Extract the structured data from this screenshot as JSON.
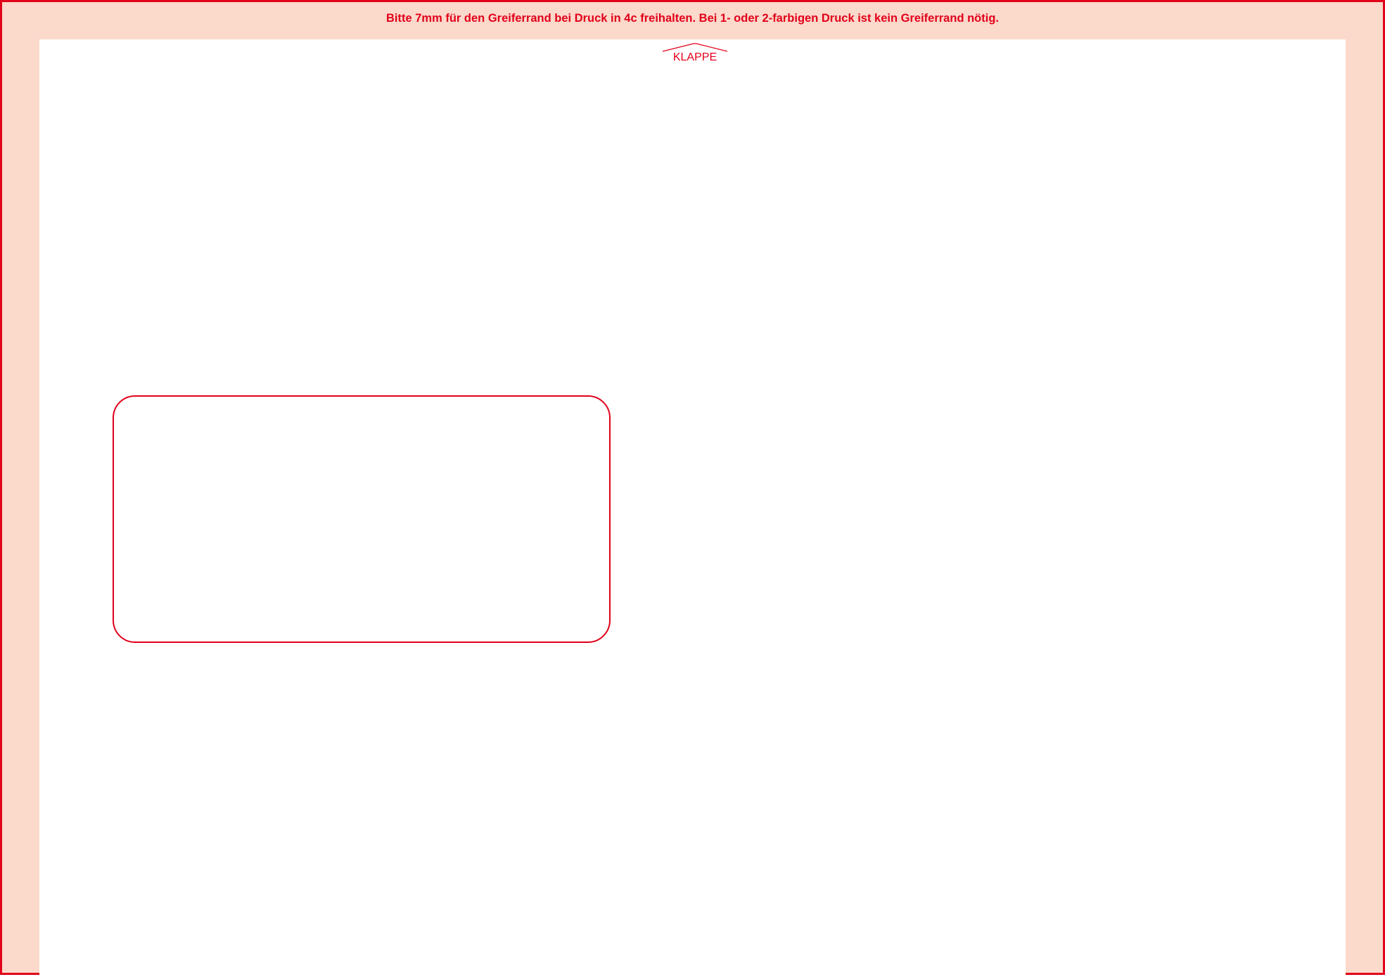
{
  "gripper_note": "Bitte 7mm für den Greiferrand bei Druck in 4c freihalten. Bei 1- oder 2-farbigen Druck ist kein Greiferrand nötig.",
  "flap_label": "KLAPPE",
  "colors": {
    "accent": "#e2001a",
    "margin_fill": "#fbd9cb",
    "background": "#ffffff"
  }
}
